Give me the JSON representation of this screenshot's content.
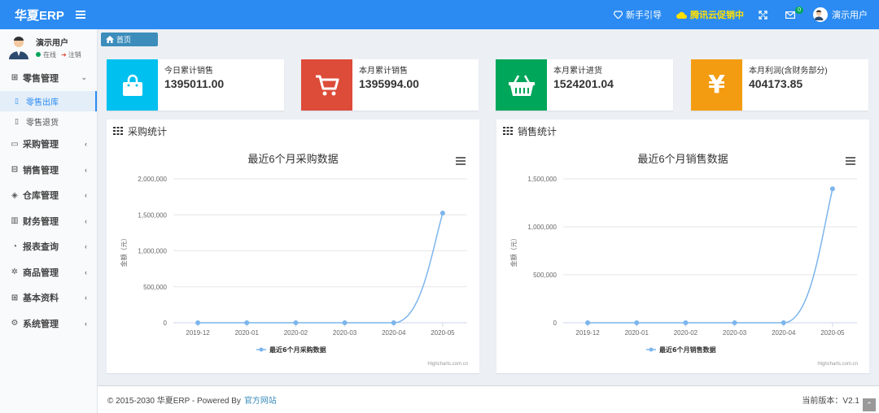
{
  "app": {
    "brand": "华夏ERP"
  },
  "topbar": {
    "guide": "新手引导",
    "promo": "腾讯云促销中",
    "mail_badge": "0",
    "user": "演示用户"
  },
  "user_panel": {
    "name": "演示用户",
    "status": "在线",
    "logout": "注销"
  },
  "sidebar": {
    "items": [
      {
        "label": "零售管理",
        "icon": "gift-icon",
        "expanded": true,
        "children": [
          {
            "label": "零售出库",
            "active": true
          },
          {
            "label": "零售退货",
            "active": false
          }
        ]
      },
      {
        "label": "采购管理",
        "icon": "monitor-icon"
      },
      {
        "label": "销售管理",
        "icon": "briefcase-icon"
      },
      {
        "label": "仓库管理",
        "icon": "layers-icon"
      },
      {
        "label": "财务管理",
        "icon": "book-icon"
      },
      {
        "label": "报表查询",
        "icon": "pie-chart-icon"
      },
      {
        "label": "商品管理",
        "icon": "gear-cube-icon"
      },
      {
        "label": "基本资料",
        "icon": "grid-icon"
      },
      {
        "label": "系统管理",
        "icon": "gear-icon"
      }
    ]
  },
  "tab": {
    "label": "首页"
  },
  "stats": [
    {
      "label": "今日累计销售",
      "value": "1395011.00",
      "color": "#00c0ef",
      "icon": "shopping-bag-icon"
    },
    {
      "label": "本月累计销售",
      "value": "1395994.00",
      "color": "#dd4b39",
      "icon": "cart-icon"
    },
    {
      "label": "本月累计进货",
      "value": "1524201.04",
      "color": "#00a65a",
      "icon": "basket-icon"
    },
    {
      "label": "本月利润(含财务部分)",
      "value": "404173.85",
      "color": "#f39c12",
      "icon": "yen-icon"
    }
  ],
  "panels": {
    "purchase": {
      "title": "采购统计"
    },
    "sales": {
      "title": "销售统计"
    }
  },
  "chart_data": [
    {
      "type": "line",
      "title": "最近6个月采购数据",
      "xlabel": "",
      "ylabel": "金额（元）",
      "categories": [
        "2019-12",
        "2020-01",
        "2020-02",
        "2020-03",
        "2020-04",
        "2020-05"
      ],
      "series": [
        {
          "name": "最近6个月采购数据",
          "values": [
            0,
            0,
            0,
            0,
            0,
            1524201
          ]
        }
      ],
      "ylim": [
        0,
        2000000
      ],
      "yticks": [
        "0",
        "500,000",
        "1,000,000",
        "1,500,000",
        "2,000,000"
      ],
      "credit": "Highcharts.com.cn",
      "legend": "bottom-center",
      "grid": true
    },
    {
      "type": "line",
      "title": "最近6个月销售数据",
      "xlabel": "",
      "ylabel": "金额（元）",
      "categories": [
        "2019-12",
        "2020-01",
        "2020-02",
        "2020-03",
        "2020-04",
        "2020-05"
      ],
      "series": [
        {
          "name": "最近6个月销售数据",
          "values": [
            0,
            0,
            0,
            0,
            0,
            1395994
          ]
        }
      ],
      "ylim": [
        0,
        1500000
      ],
      "yticks": [
        "0",
        "500,000",
        "1,000,000",
        "1,500,000"
      ],
      "credit": "Highcharts.com.cn",
      "legend": "bottom-center",
      "grid": true
    }
  ],
  "footer": {
    "copyright": "© 2015-2030 华夏ERP - Powered By",
    "link": "官方网站",
    "version_label": "当前版本：",
    "version": "V2.1"
  }
}
